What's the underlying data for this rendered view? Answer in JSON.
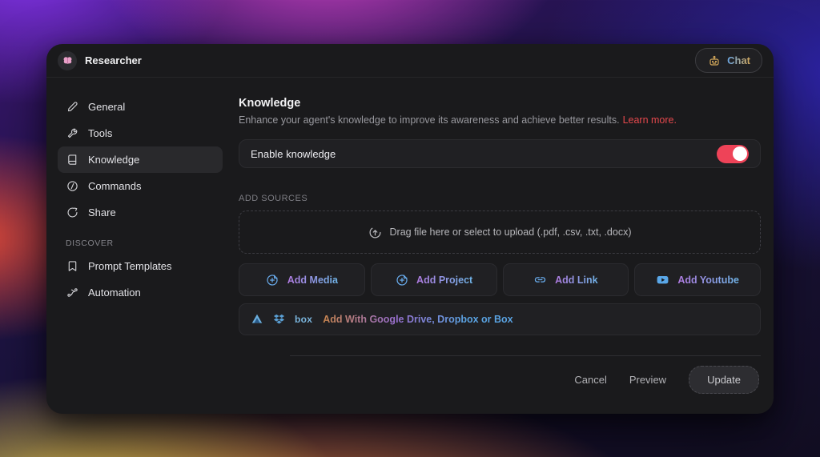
{
  "header": {
    "title": "Researcher",
    "chat_label": "Chat"
  },
  "sidebar": {
    "items": [
      {
        "label": "General"
      },
      {
        "label": "Tools"
      },
      {
        "label": "Knowledge"
      },
      {
        "label": "Commands"
      },
      {
        "label": "Share"
      }
    ],
    "section_label": "DISCOVER",
    "discover_items": [
      {
        "label": "Prompt Templates"
      },
      {
        "label": "Automation"
      }
    ]
  },
  "main": {
    "title": "Knowledge",
    "subtitle": "Enhance your agent's knowledge to improve its awareness and achieve better results.",
    "learn_more": "Learn more.",
    "enable_label": "Enable knowledge",
    "enable_state": "on",
    "add_sources_label": "ADD SOURCES",
    "dropzone_text": "Drag file here or select to upload (.pdf, .csv, .txt, .docx)",
    "add_buttons": [
      {
        "label": "Add Media"
      },
      {
        "label": "Add Project"
      },
      {
        "label": "Add Link"
      },
      {
        "label": "Add Youtube"
      }
    ],
    "box_logo": "box",
    "cloud_row_text": "Add With Google Drive, Dropbox or Box"
  },
  "footer": {
    "cancel": "Cancel",
    "preview": "Preview",
    "update": "Update"
  },
  "colors": {
    "toggle_on": "#ee4358",
    "learn_more_red": "#e5484d",
    "accent_blue": "#6aaef0",
    "gradient_purple": "#b07ae0",
    "gradient_gold": "#d4a85a"
  }
}
